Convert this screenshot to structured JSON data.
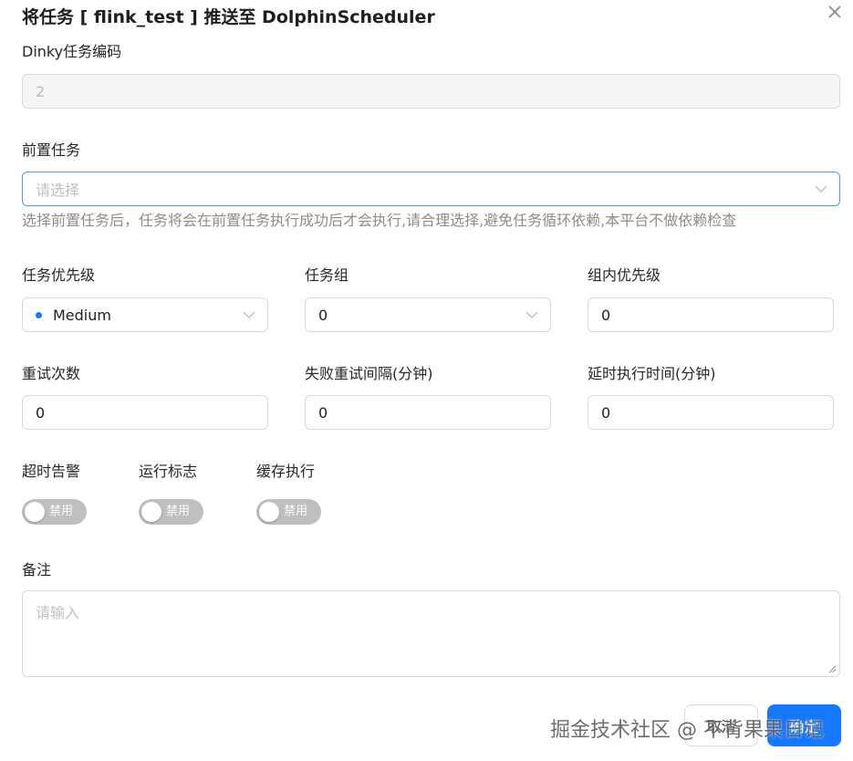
{
  "dialog": {
    "title": "将任务 [ flink_test ] 推送至 DolphinScheduler"
  },
  "fields": {
    "task_id": {
      "label": "Dinky任务编码",
      "value": "2"
    },
    "pre_task": {
      "label": "前置任务",
      "placeholder": "请选择",
      "hint": "选择前置任务后，任务将会在前置任务执行成功后才会执行,请合理选择,避免任务循环依赖,本平台不做依赖检查"
    },
    "priority": {
      "label": "任务优先级",
      "value": "Medium",
      "accent": "#1677ff"
    },
    "task_group": {
      "label": "任务组",
      "value": "0"
    },
    "group_priority": {
      "label": "组内优先级",
      "value": "0"
    },
    "retry_times": {
      "label": "重试次数",
      "value": "0"
    },
    "retry_interval": {
      "label": "失败重试间隔(分钟)",
      "value": "0"
    },
    "delay_time": {
      "label": "延时执行时间(分钟)",
      "value": "0"
    },
    "timeout_alarm": {
      "label": "超时告警",
      "state": "禁用"
    },
    "run_flag": {
      "label": "运行标志",
      "state": "禁用"
    },
    "cache_exec": {
      "label": "缓存执行",
      "state": "禁用"
    },
    "remark": {
      "label": "备注",
      "placeholder": "请输入"
    }
  },
  "buttons": {
    "cancel": "取消",
    "confirm": "确定"
  },
  "watermark": "掘金技术社区 @ 不背果果日记",
  "icons": {
    "close": "close-icon",
    "chevron": "chevron-down-icon"
  },
  "colors": {
    "primary": "#1677ff",
    "focus_border": "#4a9ce8",
    "switch_off": "#bfbfbf"
  }
}
